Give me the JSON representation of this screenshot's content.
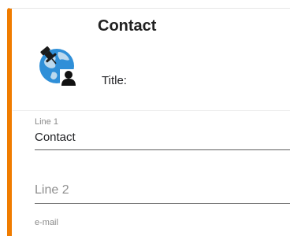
{
  "card": {
    "title": "Contact",
    "title_label": "Title:",
    "icon": "globe-pushpin-contact-icon",
    "accent_color": "#f07c00"
  },
  "fields": {
    "line1": {
      "label": "Line 1",
      "value": "Contact"
    },
    "line2": {
      "placeholder": "Line 2",
      "value": ""
    },
    "email": {
      "label": "e-mail",
      "value": ""
    }
  }
}
